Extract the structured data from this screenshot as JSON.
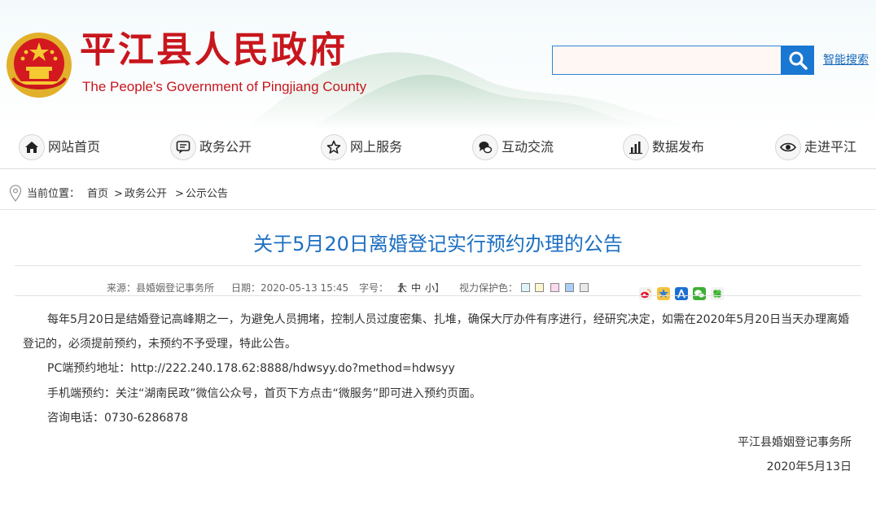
{
  "header": {
    "title_cn": "平江县人民政府",
    "title_en": "The People's Government of Pingjiang County",
    "search": {
      "placeholder": "",
      "value": "",
      "button_icon": "search-icon",
      "smart_search_label": "智能搜索"
    },
    "colors": {
      "title_red": "#c8161d",
      "search_blue": "#1a78d2"
    }
  },
  "nav": {
    "items": [
      {
        "label": "网站首页",
        "icon": "home-icon"
      },
      {
        "label": "政务公开",
        "icon": "message-icon"
      },
      {
        "label": "网上服务",
        "icon": "star-icon"
      },
      {
        "label": "互动交流",
        "icon": "chat-icon"
      },
      {
        "label": "数据发布",
        "icon": "bar-chart-icon"
      },
      {
        "label": "走进平江",
        "icon": "eye-icon"
      }
    ]
  },
  "breadcrumb": {
    "prefix": "当前位置：",
    "items": [
      "首页",
      "政务公开",
      "公示公告"
    ],
    "separator": ">"
  },
  "article": {
    "title": "关于5月20日离婚登记实行预约办理的公告",
    "meta": {
      "source": "来源：县婚姻登记事务所",
      "date": "日期：2020-05-13 15:45",
      "font_size_label": "字号：",
      "font_sizes": [
        "大",
        "中",
        "小"
      ],
      "eye_care_label": "视力保护色：",
      "eye_care_colors": [
        "#dff3fb",
        "#fff6cf",
        "#fbd9ee",
        "#a9cff4",
        "#e9e9e9"
      ],
      "share_icons": [
        "weibo-icon",
        "qzone-icon",
        "renren-icon",
        "wechat-icon",
        "clover-icon"
      ]
    },
    "body": {
      "p1_line1": "每年5月20日是结婚登记高峰期之一，为避免人员拥堵，控制人员过度密集、扎堆，确保大厅办件有序进行，经研究决定，如需在2020年5月20日当天办理离婚",
      "p1_line2": "登记的，必须提前预约，未预约不予受理，特此公告。",
      "p2": "PC端预约地址：http://222.240.178.62:8888/hdwsyy.do?method=hdwsyy",
      "p3": "手机端预约：关注“湖南民政”微信公众号，首页下方点击“微服务”即可进入预约页面。",
      "p4": "咨询电话：0730-6286878"
    },
    "signature": {
      "org": "平江县婚姻登记事务所",
      "date": "2020年5月13日"
    }
  }
}
